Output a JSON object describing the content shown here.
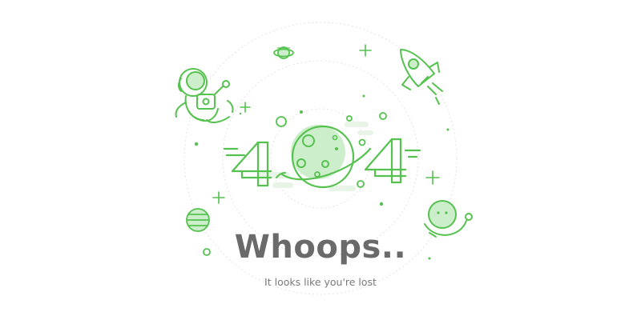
{
  "error": {
    "headline": "Whoops..",
    "message": "It looks like you're lost",
    "code_digits": [
      "4",
      "4"
    ]
  },
  "illustration_icons": [
    "astronaut-icon",
    "planet-globe-icon",
    "rocket-icon",
    "ringed-planet-icon",
    "striped-planet-icon",
    "smiling-planet-icon",
    "sparkle-icon"
  ],
  "colors": {
    "accent": "#55c24f",
    "accent_light": "#cdeecb",
    "accent_pale": "#e8f5e6",
    "text_headline": "#6a6a6a",
    "text_message": "#7a7a7a",
    "orbit": "#e3e3e3",
    "background": "#ffffff"
  }
}
